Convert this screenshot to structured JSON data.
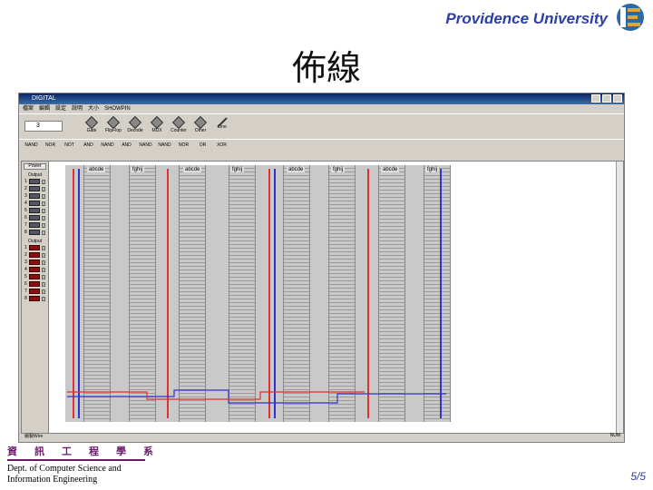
{
  "header": {
    "brand": "Providence University",
    "logo": "ie-logo"
  },
  "slide": {
    "title": "佈線"
  },
  "window": {
    "title": "DIGITAL",
    "menu": [
      "檔案",
      "編輯",
      "設定",
      "說明",
      "大小",
      "SHOWPIN"
    ],
    "combo_value": "3",
    "toolbar1": [
      "Gate",
      "FlipFlop",
      "Decode",
      "MUX",
      "Counter",
      "Other",
      "Line"
    ],
    "toolbar2": [
      "NAND",
      "NOR",
      "NOT",
      "AND",
      "NAND",
      "AND",
      "NAND",
      "NAND",
      "NOR",
      "OR",
      "XOR"
    ],
    "side": {
      "power": "Power",
      "input_label": "Output",
      "output_label": "Output",
      "rows": [
        "1",
        "2",
        "3",
        "4",
        "5",
        "6",
        "7",
        "8"
      ]
    },
    "chips": [
      "abcde",
      "fghij",
      "abcde",
      "fghij",
      "abcde",
      "fghij",
      "abcde",
      "fghij"
    ],
    "status_left": "繪製Wire",
    "status_right": "NUM"
  },
  "footer": {
    "chinese": [
      "資",
      "訊",
      "工",
      "程",
      "學",
      "系"
    ],
    "dept_line1": "Dept. of Computer Science and",
    "dept_line2": "Information Engineering",
    "page": "5/5"
  },
  "colors": {
    "brand": "#2b3fa6",
    "footer_accent": "#6b1a6b"
  }
}
